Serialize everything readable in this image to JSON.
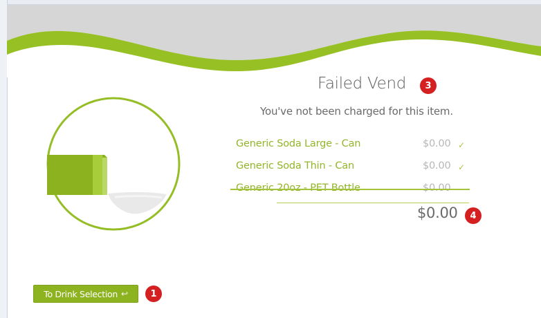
{
  "header": {
    "title": "Failed Vend",
    "subtitle": "You've not been charged for this item."
  },
  "items": [
    {
      "name": "Generic Soda Large - Can",
      "price": "$0.00",
      "status": "check",
      "struck": false
    },
    {
      "name": "Generic Soda Thin - Can",
      "price": "$0.00",
      "status": "check",
      "struck": false
    },
    {
      "name": "Generic 20oz - PET Bottle",
      "price": "$0.00",
      "status": "none",
      "struck": true
    }
  ],
  "total": "$0.00",
  "button": {
    "label": "To Drink Selection",
    "icon": "return-arrow-icon"
  },
  "annotations": [
    "1",
    "3",
    "4"
  ],
  "colors": {
    "accent": "#8db321",
    "wave_gray": "#d8d8d8",
    "badge": "#d42020"
  }
}
